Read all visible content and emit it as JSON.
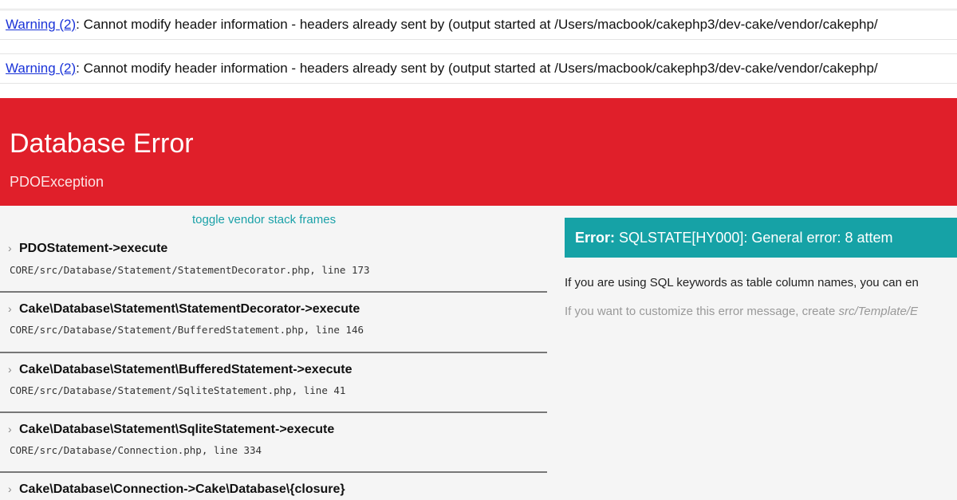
{
  "warnings": [
    {
      "link": "Warning (2)",
      "message": ": Cannot modify header information - headers already sent by (output started at /Users/macbook/cakephp3/dev-cake/vendor/cakephp/"
    },
    {
      "link": "Warning (2)",
      "message": ": Cannot modify header information - headers already sent by (output started at /Users/macbook/cakephp3/dev-cake/vendor/cakephp/"
    }
  ],
  "header": {
    "title": "Database Error",
    "subtitle": "PDOException",
    "color": "#e01f2a"
  },
  "stack": {
    "toggle_label": "toggle vendor stack frames",
    "frames": [
      {
        "title": "PDOStatement->execute",
        "path": "CORE/src/Database/Statement/StatementDecorator.php, line 173"
      },
      {
        "title": "Cake\\Database\\Statement\\StatementDecorator->execute",
        "path": "CORE/src/Database/Statement/BufferedStatement.php, line 146"
      },
      {
        "title": "Cake\\Database\\Statement\\BufferedStatement->execute",
        "path": "CORE/src/Database/Statement/SqliteStatement.php, line 41"
      },
      {
        "title": "Cake\\Database\\Statement\\SqliteStatement->execute",
        "path": "CORE/src/Database/Connection.php, line 334"
      },
      {
        "title": "Cake\\Database\\Connection->Cake\\Database\\{closure}",
        "path": ""
      }
    ]
  },
  "error": {
    "label": "Error:",
    "message": " SQLSTATE[HY000]: General error: 8 attem",
    "color": "#16a2a6"
  },
  "hint": "If you are using SQL keywords as table column names, you can en",
  "customize": {
    "prefix": "If you want to customize this error message, create ",
    "path": "src/Template/E"
  }
}
